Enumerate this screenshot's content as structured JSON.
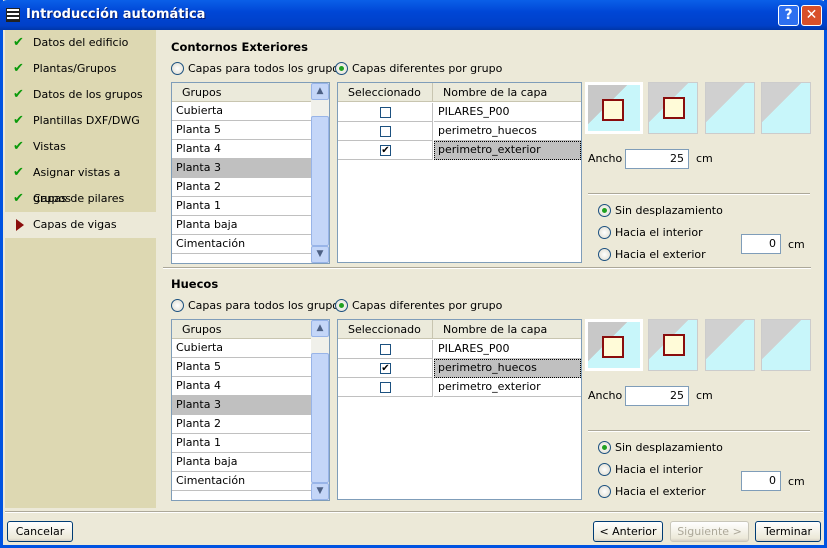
{
  "window": {
    "title": "Introducción automática",
    "help": "?",
    "close": "✕"
  },
  "sidebar": {
    "items": [
      {
        "label": "Datos del edificio",
        "done": true
      },
      {
        "label": "Plantas/Grupos",
        "done": true
      },
      {
        "label": "Datos de los grupos",
        "done": true
      },
      {
        "label": "Plantillas DXF/DWG",
        "done": true
      },
      {
        "label": "Vistas",
        "done": true
      },
      {
        "label": "Asignar vistas a grupos",
        "done": true
      },
      {
        "label": "Capas de pilares",
        "done": true
      },
      {
        "label": "Capas de vigas",
        "done": false,
        "active": true
      }
    ],
    "check": "✔"
  },
  "sections": [
    {
      "title": "Contornos Exteriores",
      "radio_all": "Capas para todos los grupos",
      "radio_diff": "Capas diferentes por grupo",
      "groups_header": "Grupos",
      "groups": [
        "Cubierta",
        "Planta 5",
        "Planta 4",
        "Planta 3",
        "Planta 2",
        "Planta 1",
        "Planta baja",
        "Cimentación"
      ],
      "selected_group": 3,
      "layers_header": [
        "Seleccionado",
        "Nombre de la capa"
      ],
      "layers": [
        {
          "name": "PILARES_P00",
          "checked": false
        },
        {
          "name": "perimetro_huecos",
          "checked": false
        },
        {
          "name": "perimetro_exterior",
          "checked": true
        }
      ],
      "selected_layer": 2,
      "ancho_label": "Ancho",
      "ancho": "25",
      "unit": "cm",
      "offset_options": [
        "Sin desplazamiento",
        "Hacia el interior",
        "Hacia el exterior"
      ],
      "offset_selected": 0,
      "offset": "0"
    },
    {
      "title": "Huecos",
      "radio_all": "Capas para todos los grupos",
      "radio_diff": "Capas diferentes por grupo",
      "groups_header": "Grupos",
      "groups": [
        "Cubierta",
        "Planta 5",
        "Planta 4",
        "Planta 3",
        "Planta 2",
        "Planta 1",
        "Planta baja",
        "Cimentación"
      ],
      "selected_group": 3,
      "layers_header": [
        "Seleccionado",
        "Nombre de la capa"
      ],
      "layers": [
        {
          "name": "PILARES_P00",
          "checked": false
        },
        {
          "name": "perimetro_huecos",
          "checked": true
        },
        {
          "name": "perimetro_exterior",
          "checked": false
        }
      ],
      "selected_layer": 1,
      "ancho_label": "Ancho",
      "ancho": "25",
      "unit": "cm",
      "offset_options": [
        "Sin desplazamiento",
        "Hacia el interior",
        "Hacia el exterior"
      ],
      "offset_selected": 0,
      "offset": "0"
    }
  ],
  "footer": {
    "cancel": "Cancelar",
    "back": "< Anterior",
    "next": "Siguiente >",
    "finish": "Terminar"
  }
}
